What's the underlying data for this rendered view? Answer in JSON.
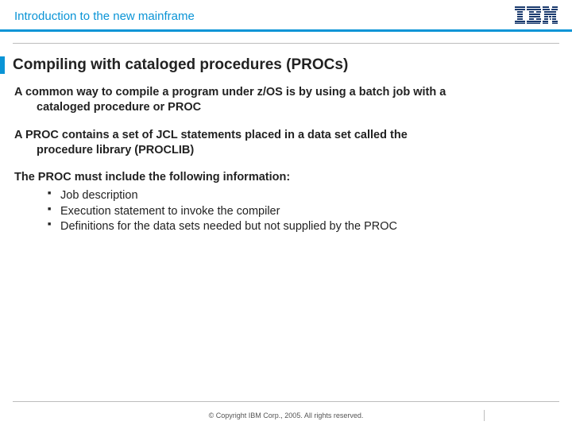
{
  "header": {
    "title": "Introduction to the new mainframe",
    "logo_alt": "IBM"
  },
  "slide": {
    "title": "Compiling with cataloged procedures (PROCs)"
  },
  "paragraphs": {
    "p1_lead": "A common way to compile a program under z/OS is by using a batch job with a",
    "p1_cont": "cataloged procedure or PROC",
    "p2_lead": "A PROC contains a set of JCL statements placed in a data set called the",
    "p2_cont": "procedure library (PROCLIB)",
    "p3": "The PROC must include the following information:"
  },
  "bullets": [
    "Job description",
    "Execution statement to invoke the compiler",
    "Definitions for the data sets needed but not supplied by the PROC"
  ],
  "footer": {
    "copyright": "© Copyright IBM Corp., 2005. All rights reserved."
  }
}
